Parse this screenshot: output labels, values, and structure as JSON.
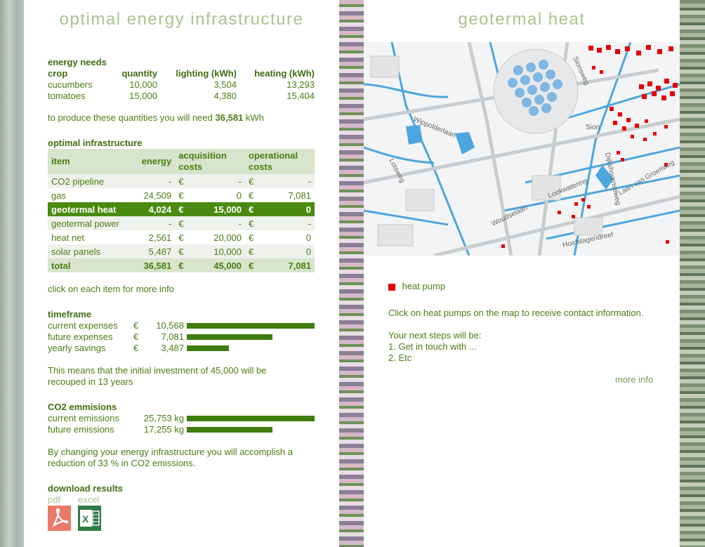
{
  "left": {
    "title": "optimal energy infrastructure",
    "energy_needs": {
      "heading": "energy needs",
      "columns": [
        "crop",
        "quantity",
        "lighting (kWh)",
        "heating (kWh)"
      ],
      "rows": [
        [
          "cucumbers",
          "10,000",
          "3,504",
          "13,293"
        ],
        [
          "tomatoes",
          "15,000",
          "4,380",
          "15,404"
        ]
      ]
    },
    "produce_text": "to produce these quantities you will need",
    "produce_value": "36,581",
    "produce_unit": "kWh",
    "infra": {
      "heading": "optimal infrastructure",
      "columns": [
        "item",
        "energy",
        "acquisition costs",
        "operational costs"
      ],
      "rows": [
        {
          "item": "CO2 pipeline",
          "energy": "-",
          "cur1": "€",
          "acq": "-",
          "cur2": "€",
          "op": "-"
        },
        {
          "item": "gas",
          "energy": "24,509",
          "cur1": "€",
          "acq": "0",
          "cur2": "€",
          "op": "7,081"
        },
        {
          "item": "geotermal heat",
          "energy": "4,024",
          "cur1": "€",
          "acq": "15,000",
          "cur2": "€",
          "op": "0"
        },
        {
          "item": "geotermal power",
          "energy": "-",
          "cur1": "€",
          "acq": "-",
          "cur2": "€",
          "op": "-"
        },
        {
          "item": "heat net",
          "energy": "2,561",
          "cur1": "€",
          "acq": "20,000",
          "cur2": "€",
          "op": "0"
        },
        {
          "item": "solar panels",
          "energy": "5,487",
          "cur1": "€",
          "acq": "10,000",
          "cur2": "€",
          "op": "0"
        }
      ],
      "total": {
        "item": "total",
        "energy": "36,581",
        "cur1": "€",
        "acq": "45,000",
        "cur2": "€",
        "op": "7,081"
      },
      "hint": "click on each item for more info"
    },
    "timeframe": {
      "heading": "timeframe",
      "rows": [
        {
          "label": "current expenses",
          "cur": "€",
          "value": "10,568",
          "fraction": 1.0
        },
        {
          "label": "future expenses",
          "cur": "€",
          "value": "7,081",
          "fraction": 0.67
        },
        {
          "label": "yearly savings",
          "cur": "€",
          "value": "3,487",
          "fraction": 0.33
        }
      ],
      "note": "This means that the initial investment of 45,000 will be recouped in 13 years"
    },
    "co2": {
      "heading": "CO2 emmisions",
      "rows": [
        {
          "label": "current emissions",
          "value": "25,753 kg",
          "fraction": 1.0
        },
        {
          "label": "future emissions",
          "value": "17,255 kg",
          "fraction": 0.67
        }
      ],
      "note": "By changing your energy infrastructure you will accomplish a reduction of 33 % in CO2 emissions."
    },
    "download": {
      "heading": "download results",
      "pdf_label": "pdf",
      "excel_label": "excel"
    }
  },
  "right": {
    "title": "geotermal heat",
    "map_labels": [
      "Wippolderlaan",
      "Lotsweg",
      "Sionsweg",
      "Sion",
      "Dijkshoornseweg",
      "Laan van Groenweg",
      "Lookwatering",
      "Woudselaan",
      "Hoefslagendreef"
    ],
    "legend_label": "heat pump",
    "instructions": "Click on heat pumps on the map to receive contact information.",
    "next_steps_heading": "Your next steps will be:",
    "steps": [
      "1. Get in touch with ...",
      "2. Etc"
    ],
    "more_info": "more info",
    "colors": {
      "accent": "#4b8a10",
      "title": "#a9c58c",
      "heat_pump": "#e40000",
      "water": "#4da6de"
    }
  }
}
